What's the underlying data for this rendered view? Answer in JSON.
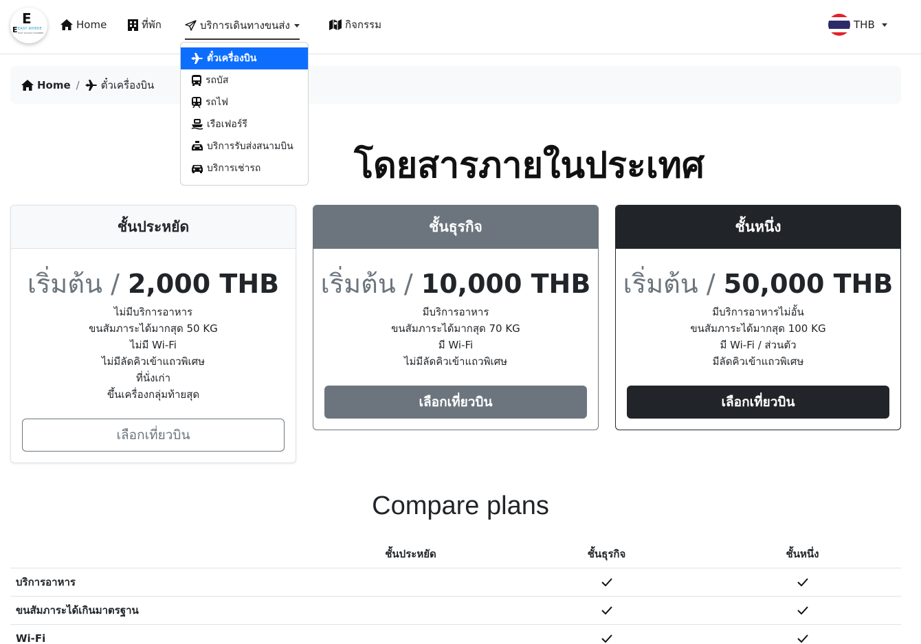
{
  "nav": {
    "logo_letter": "E",
    "logo_letter_small": "E",
    "logo_tagline": "EASY WHERE",
    "logo_subtagline": "EASY GO EASY PLANNER",
    "home": "Home",
    "accommodation": "ที่พัก",
    "transport": "บริการเดินทางขนส่ง",
    "activities": "กิจกรรม",
    "currency": "THB"
  },
  "dropdown": {
    "items": [
      {
        "label": "ตั๋วเครื่องบิน",
        "icon": "plane-icon",
        "active": true
      },
      {
        "label": "รถบัส",
        "icon": "bus-icon",
        "active": false
      },
      {
        "label": "รถไฟ",
        "icon": "train-icon",
        "active": false
      },
      {
        "label": "เรือเฟอร์รี",
        "icon": "ferry-icon",
        "active": false
      },
      {
        "label": "บริการรับส่งสนามบิน",
        "icon": "taxi-icon",
        "active": false
      },
      {
        "label": "บริการเช่ารถ",
        "icon": "car-icon",
        "active": false
      }
    ]
  },
  "breadcrumb": {
    "home": "Home",
    "current": "ตั๋วเครื่องบิน",
    "separator": "/"
  },
  "hero": {
    "title_visible": "โดยสารภายในประเทศ"
  },
  "plans": [
    {
      "name": "ชั้นประหยัด",
      "price_prefix": "เริ่มต้น",
      "price": "2,000 THB",
      "features": [
        "ไม่มีบริการอาหาร",
        "ขนสัมภาระได้มากสุด 50 KG",
        "ไม่มี Wi-Fi",
        "ไม่มีลัดคิวเข้าแถวพิเศษ",
        "ที่นั่งเก่า",
        "ขึ้นเครื่องกลุ่มท้ายสุด"
      ],
      "button": "เลือกเที่ยวบิน"
    },
    {
      "name": "ชั้นธุรกิจ",
      "price_prefix": "เริ่มต้น",
      "price": "10,000 THB",
      "features": [
        "มีบริการอาหาร",
        "ขนสัมภาระได้มากสุด 70 KG",
        "มี Wi-Fi",
        "ไม่มีลัดคิวเข้าแถวพิเศษ"
      ],
      "button": "เลือกเที่ยวบิน"
    },
    {
      "name": "ชั้นหนึ่ง",
      "price_prefix": "เริ่มต้น",
      "price": "50,000 THB",
      "features": [
        "มีบริการอาหารไม่อั้น",
        "ขนสัมภาระได้มากสุด 100 KG",
        "มี Wi-Fi / ส่วนตัว",
        "มีลัดคิวเข้าแถวพิเศษ"
      ],
      "button": "เลือกเที่ยวบิน"
    }
  ],
  "compare": {
    "title": "Compare plans",
    "columns": [
      "ชั้นประหยัด",
      "ชั้นธุรกิจ",
      "ชั้นหนึ่ง"
    ],
    "rows": [
      {
        "label": "บริการอาหาร",
        "checks": [
          false,
          true,
          true
        ]
      },
      {
        "label": "ขนสัมภาระได้เกินมาตรฐาน",
        "checks": [
          false,
          true,
          true
        ]
      },
      {
        "label": "Wi-Fi",
        "checks": [
          false,
          true,
          true
        ]
      }
    ]
  }
}
